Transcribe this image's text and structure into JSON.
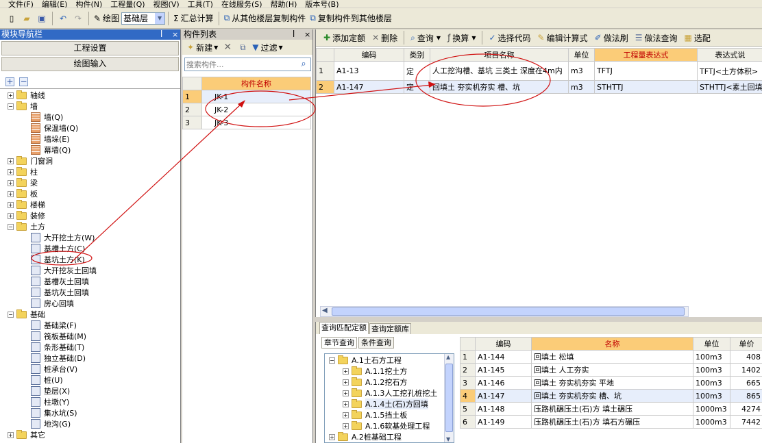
{
  "menu": [
    "文件(F)",
    "编辑(E)",
    "构件(N)",
    "工程量(Q)",
    "视图(V)",
    "工具(T)",
    "在线服务(S)",
    "帮助(H)",
    "版本号(B)"
  ],
  "toolbar": {
    "draw_label": "绘图",
    "floor_value": "基础层",
    "summary_label": "汇总计算",
    "copy_from_label": "从其他楼层复制构件",
    "copy_to_label": "复制构件到其他楼层"
  },
  "nav": {
    "title": "模块导航栏",
    "pin": "ꟾ",
    "close": "×",
    "btn_project_settings": "工程设置",
    "btn_drawing_input": "绘图输入",
    "tree": [
      {
        "label": "轴线",
        "level": 0,
        "type": "folder",
        "exp": "+"
      },
      {
        "label": "墙",
        "level": 0,
        "type": "folder",
        "exp": "−"
      },
      {
        "label": "墙(Q)",
        "level": 1,
        "type": "wall"
      },
      {
        "label": "保温墙(Q)",
        "level": 1,
        "type": "wall"
      },
      {
        "label": "墙垛(E)",
        "level": 1,
        "type": "wall"
      },
      {
        "label": "幕墙(Q)",
        "level": 1,
        "type": "wall"
      },
      {
        "label": "门窗洞",
        "level": 0,
        "type": "folder",
        "exp": "+"
      },
      {
        "label": "柱",
        "level": 0,
        "type": "folder",
        "exp": "+"
      },
      {
        "label": "梁",
        "level": 0,
        "type": "folder",
        "exp": "+"
      },
      {
        "label": "板",
        "level": 0,
        "type": "folder",
        "exp": "+"
      },
      {
        "label": "楼梯",
        "level": 0,
        "type": "folder",
        "exp": "+"
      },
      {
        "label": "装修",
        "level": 0,
        "type": "folder",
        "exp": "+"
      },
      {
        "label": "土方",
        "level": 0,
        "type": "folder",
        "exp": "−"
      },
      {
        "label": "大开挖土方(W)",
        "level": 1,
        "type": "leaf"
      },
      {
        "label": "基槽土方(C)",
        "level": 1,
        "type": "leaf"
      },
      {
        "label": "基坑土方(K)",
        "level": 1,
        "type": "leaf"
      },
      {
        "label": "大开挖灰土回填",
        "level": 1,
        "type": "leaf"
      },
      {
        "label": "基槽灰土回填",
        "level": 1,
        "type": "leaf"
      },
      {
        "label": "基坑灰土回填",
        "level": 1,
        "type": "leaf"
      },
      {
        "label": "房心回填",
        "level": 1,
        "type": "leaf"
      },
      {
        "label": "基础",
        "level": 0,
        "type": "folder",
        "exp": "−"
      },
      {
        "label": "基础梁(F)",
        "level": 1,
        "type": "leaf"
      },
      {
        "label": "筏板基础(M)",
        "level": 1,
        "type": "leaf"
      },
      {
        "label": "条形基础(T)",
        "level": 1,
        "type": "leaf"
      },
      {
        "label": "独立基础(D)",
        "level": 1,
        "type": "leaf"
      },
      {
        "label": "桩承台(V)",
        "level": 1,
        "type": "leaf"
      },
      {
        "label": "桩(U)",
        "level": 1,
        "type": "leaf"
      },
      {
        "label": "垫层(X)",
        "level": 1,
        "type": "leaf"
      },
      {
        "label": "柱墩(Y)",
        "level": 1,
        "type": "leaf"
      },
      {
        "label": "集水坑(S)",
        "level": 1,
        "type": "leaf"
      },
      {
        "label": "地沟(G)",
        "level": 1,
        "type": "leaf"
      },
      {
        "label": "其它",
        "level": 0,
        "type": "folder",
        "exp": "+"
      }
    ]
  },
  "complist": {
    "title": "构件列表",
    "new_label": "新建",
    "filter_label": "过滤",
    "search_placeholder": "搜索构件...",
    "col_name": "构件名称",
    "rows": [
      {
        "n": "1",
        "name": "JK-1"
      },
      {
        "n": "2",
        "name": "JK-2"
      },
      {
        "n": "3",
        "name": "JK-3"
      }
    ]
  },
  "quota": {
    "toolbar": [
      "添加定额",
      "删除",
      "查询",
      "换算",
      "选择代码",
      "编辑计算式",
      "做法刷",
      "做法查询",
      "选配"
    ],
    "headers": [
      "编码",
      "类别",
      "项目名称",
      "单位",
      "工程量表达式",
      "表达式说"
    ],
    "rows": [
      {
        "n": "1",
        "code": "A1-13",
        "cat": "定",
        "name": "人工挖沟槽、基坑 三类土 深度在4m内",
        "unit": "m3",
        "expr": "TFTJ",
        "desc": "TFTJ<土方体积>"
      },
      {
        "n": "2",
        "code": "A1-147",
        "cat": "定",
        "name": "回填土 夯实机夯实 槽、坑",
        "unit": "m3",
        "expr": "STHTTJ",
        "desc": "STHTTJ<素土回填体"
      }
    ]
  },
  "query": {
    "tab_match": "查询匹配定额",
    "tab_lib": "查询定额库",
    "subtab_chapter": "章节查询",
    "subtab_condition": "条件查询",
    "tree": [
      {
        "label": "A.1土石方工程",
        "level": 0,
        "exp": "−"
      },
      {
        "label": "A.1.1挖土方",
        "level": 1,
        "exp": "+"
      },
      {
        "label": "A.1.2挖石方",
        "level": 1,
        "exp": "+"
      },
      {
        "label": "A.1.3人工挖孔桩挖土",
        "level": 1,
        "exp": "+"
      },
      {
        "label": "A.1.4土(石)方回填",
        "level": 1,
        "exp": "+"
      },
      {
        "label": "A.1.5挡土板",
        "level": 1,
        "exp": "+"
      },
      {
        "label": "A.1.6软基处理工程",
        "level": 1,
        "exp": "+"
      },
      {
        "label": "A.2桩基础工程",
        "level": 0,
        "exp": "+"
      }
    ],
    "headers": [
      "编码",
      "名称",
      "单位",
      "单价"
    ],
    "rows": [
      {
        "n": "1",
        "code": "A1-144",
        "name": "回填土 松填",
        "unit": "100m3",
        "price": "408"
      },
      {
        "n": "2",
        "code": "A1-145",
        "name": "回填土 人工夯实",
        "unit": "100m3",
        "price": "1402"
      },
      {
        "n": "3",
        "code": "A1-146",
        "name": "回填土 夯实机夯实 平地",
        "unit": "100m3",
        "price": "665"
      },
      {
        "n": "4",
        "code": "A1-147",
        "name": "回填土 夯实机夯实 槽、坑",
        "unit": "100m3",
        "price": "865"
      },
      {
        "n": "5",
        "code": "A1-148",
        "name": "压路机碾压土(石)方 填土碾压",
        "unit": "1000m3",
        "price": "4274"
      },
      {
        "n": "6",
        "code": "A1-149",
        "name": "压路机碾压土(石)方 填石方碾压",
        "unit": "1000m3",
        "price": "7442"
      }
    ]
  }
}
